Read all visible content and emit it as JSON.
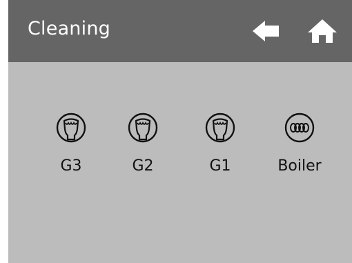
{
  "header": {
    "title": "Cleaning",
    "back_icon": "back-arrow-icon",
    "home_icon": "home-icon"
  },
  "colors": {
    "header_bg": "#656565",
    "screen_bg": "#bcbcbc",
    "icon_fill": "#ffffff",
    "text": "#111111"
  },
  "options": [
    {
      "label": "G3",
      "icon": "group-head-icon"
    },
    {
      "label": "G2",
      "icon": "group-head-icon"
    },
    {
      "label": "G1",
      "icon": "group-head-icon"
    },
    {
      "label": "Boiler",
      "icon": "boiler-coil-icon"
    }
  ]
}
